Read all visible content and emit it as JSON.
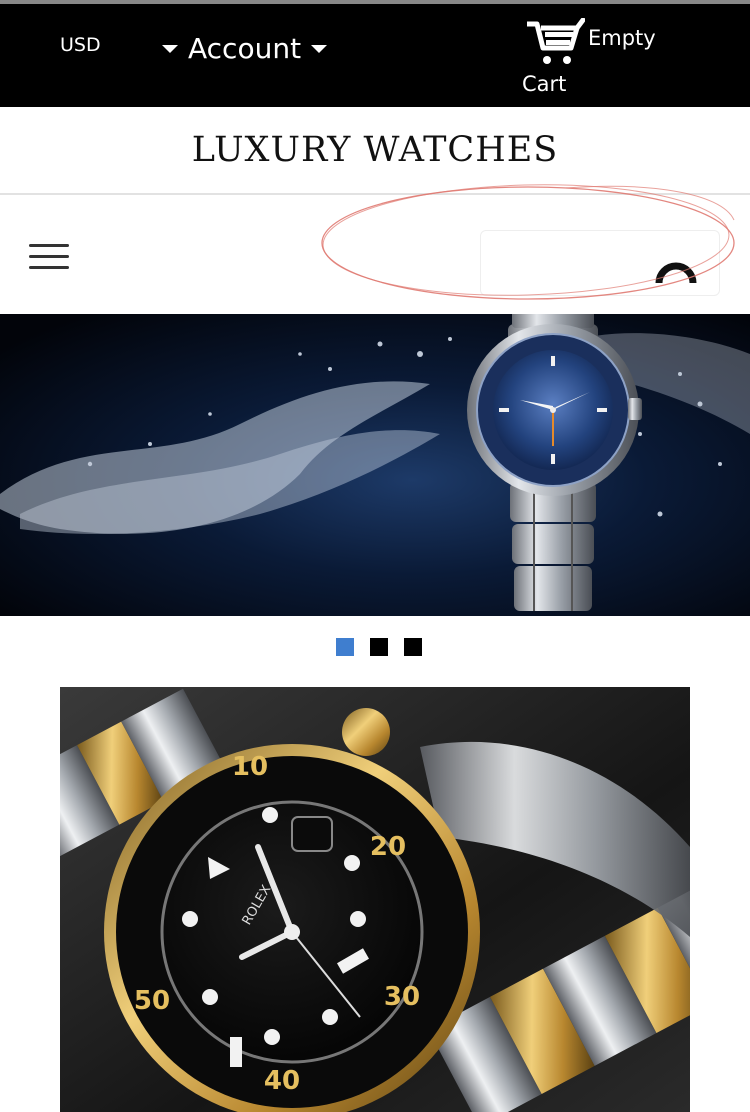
{
  "header": {
    "currency": "USD",
    "account_label": "Account",
    "cart_status": "Empty",
    "cart_label": "Cart"
  },
  "brand": {
    "title": "LUXURY WATCHES"
  },
  "search": {
    "placeholder": ""
  },
  "hero": {
    "image": "blue-dial-dive-watch-with-water-splash",
    "slides": [
      {
        "active": true
      },
      {
        "active": false
      },
      {
        "active": false
      }
    ]
  },
  "product": {
    "image": "black-and-gold-rolex-submariner"
  },
  "colors": {
    "topbar": "#000000",
    "accent": "#3f7ecf",
    "annotation": "#e07a72"
  },
  "icons": [
    "caret-down-icon",
    "cart-icon",
    "hamburger-icon",
    "loading-spinner-icon"
  ]
}
